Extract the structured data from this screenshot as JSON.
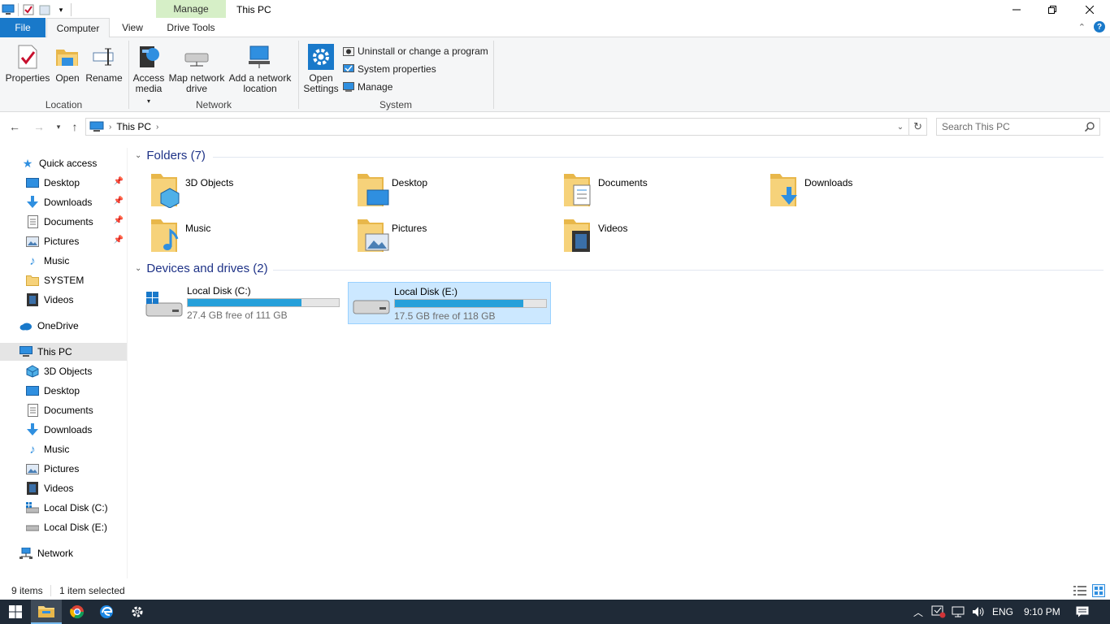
{
  "title_bar": {
    "context_tab": "Manage",
    "title": "This PC"
  },
  "ribbon_tabs": {
    "file": "File",
    "computer": "Computer",
    "view": "View",
    "drive_tools": "Drive Tools"
  },
  "ribbon": {
    "location": {
      "label": "Location",
      "properties": "Properties",
      "open": "Open",
      "rename": "Rename"
    },
    "network": {
      "label": "Network",
      "access_media": "Access media",
      "map_drive": "Map network drive",
      "add_location": "Add a network location"
    },
    "system": {
      "label": "System",
      "open_settings": "Open Settings",
      "uninstall": "Uninstall or change a program",
      "system_properties": "System properties",
      "manage": "Manage"
    }
  },
  "address": {
    "path": "This PC",
    "search_placeholder": "Search This PC"
  },
  "sidebar": {
    "quick_access": "Quick access",
    "qa_items": [
      {
        "label": "Desktop",
        "icon": "desktop-icon"
      },
      {
        "label": "Downloads",
        "icon": "downloads-icon"
      },
      {
        "label": "Documents",
        "icon": "documents-icon"
      },
      {
        "label": "Pictures",
        "icon": "pictures-icon"
      },
      {
        "label": "Music",
        "icon": "music-icon"
      },
      {
        "label": "SYSTEM",
        "icon": "folder-icon"
      },
      {
        "label": "Videos",
        "icon": "videos-icon"
      }
    ],
    "onedrive": "OneDrive",
    "this_pc": "This PC",
    "pc_items": [
      {
        "label": "3D Objects"
      },
      {
        "label": "Desktop"
      },
      {
        "label": "Documents"
      },
      {
        "label": "Downloads"
      },
      {
        "label": "Music"
      },
      {
        "label": "Pictures"
      },
      {
        "label": "Videos"
      },
      {
        "label": "Local Disk (C:)"
      },
      {
        "label": "Local Disk (E:)"
      }
    ],
    "network": "Network"
  },
  "content": {
    "folders_header": "Folders (7)",
    "folders": [
      "3D Objects",
      "Desktop",
      "Documents",
      "Downloads",
      "Music",
      "Pictures",
      "Videos"
    ],
    "drives_header": "Devices and drives (2)",
    "drives": [
      {
        "name": "Local Disk (C:)",
        "free": "27.4 GB free of 111 GB",
        "used_fraction": 0.75
      },
      {
        "name": "Local Disk (E:)",
        "free": "17.5 GB free of 118 GB",
        "used_fraction": 0.85
      }
    ]
  },
  "status": {
    "items": "9 items",
    "selected": "1 item selected"
  },
  "taskbar": {
    "language": "ENG",
    "time": "9:10 PM"
  },
  "colors": {
    "accent": "#1979ca",
    "drive_bar": "#26a0da",
    "taskbar": "#1f2a37",
    "context_tab": "#d6efc7"
  }
}
